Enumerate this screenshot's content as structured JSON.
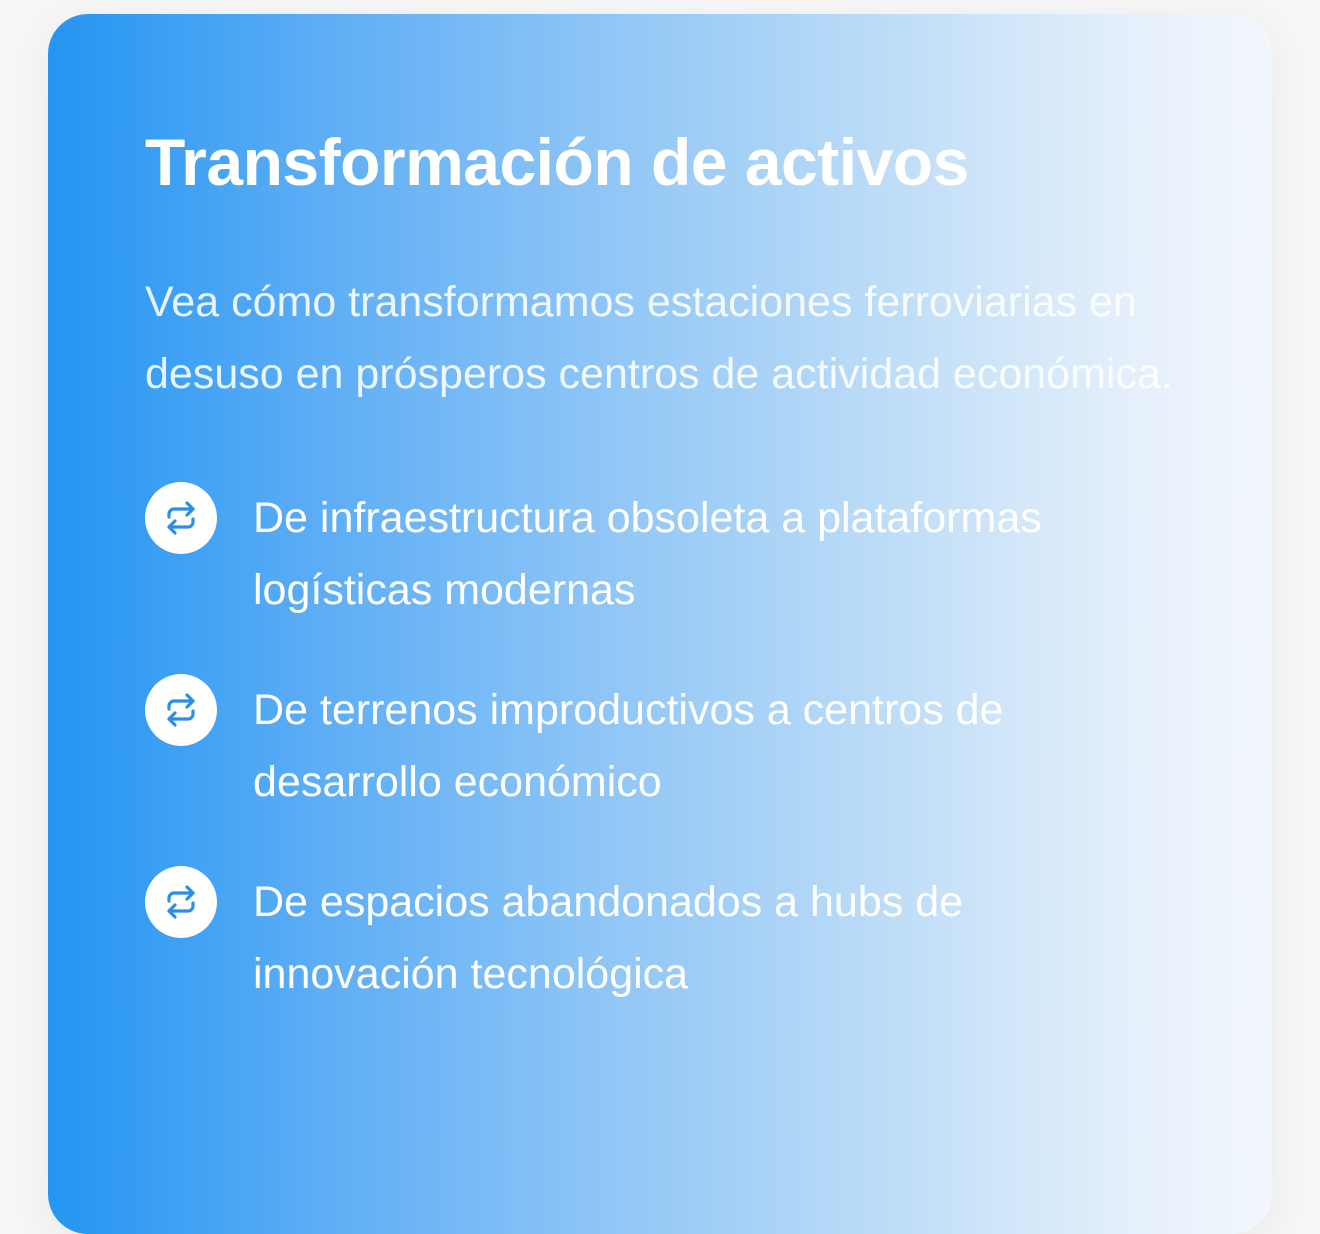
{
  "card": {
    "title": "Transformación de activos",
    "description": "Vea cómo transformamos estaciones ferroviarias en desuso en prósperos centros de actividad económica.",
    "items": [
      {
        "icon": "swap-arrows-icon",
        "text": "De infraestructura obsoleta a plataformas logísticas modernas"
      },
      {
        "icon": "swap-arrows-icon",
        "text": "De terrenos improductivos a centros de desarrollo económico"
      },
      {
        "icon": "swap-arrows-icon",
        "text": "De espacios abandonados a hubs de innovación tecnológica"
      }
    ]
  },
  "colors": {
    "gradient_start": "#2495f2",
    "gradient_end": "#f3f7fc",
    "icon_background": "#ffffff",
    "icon_stroke": "#2a8fe8",
    "text": "#ffffff"
  }
}
